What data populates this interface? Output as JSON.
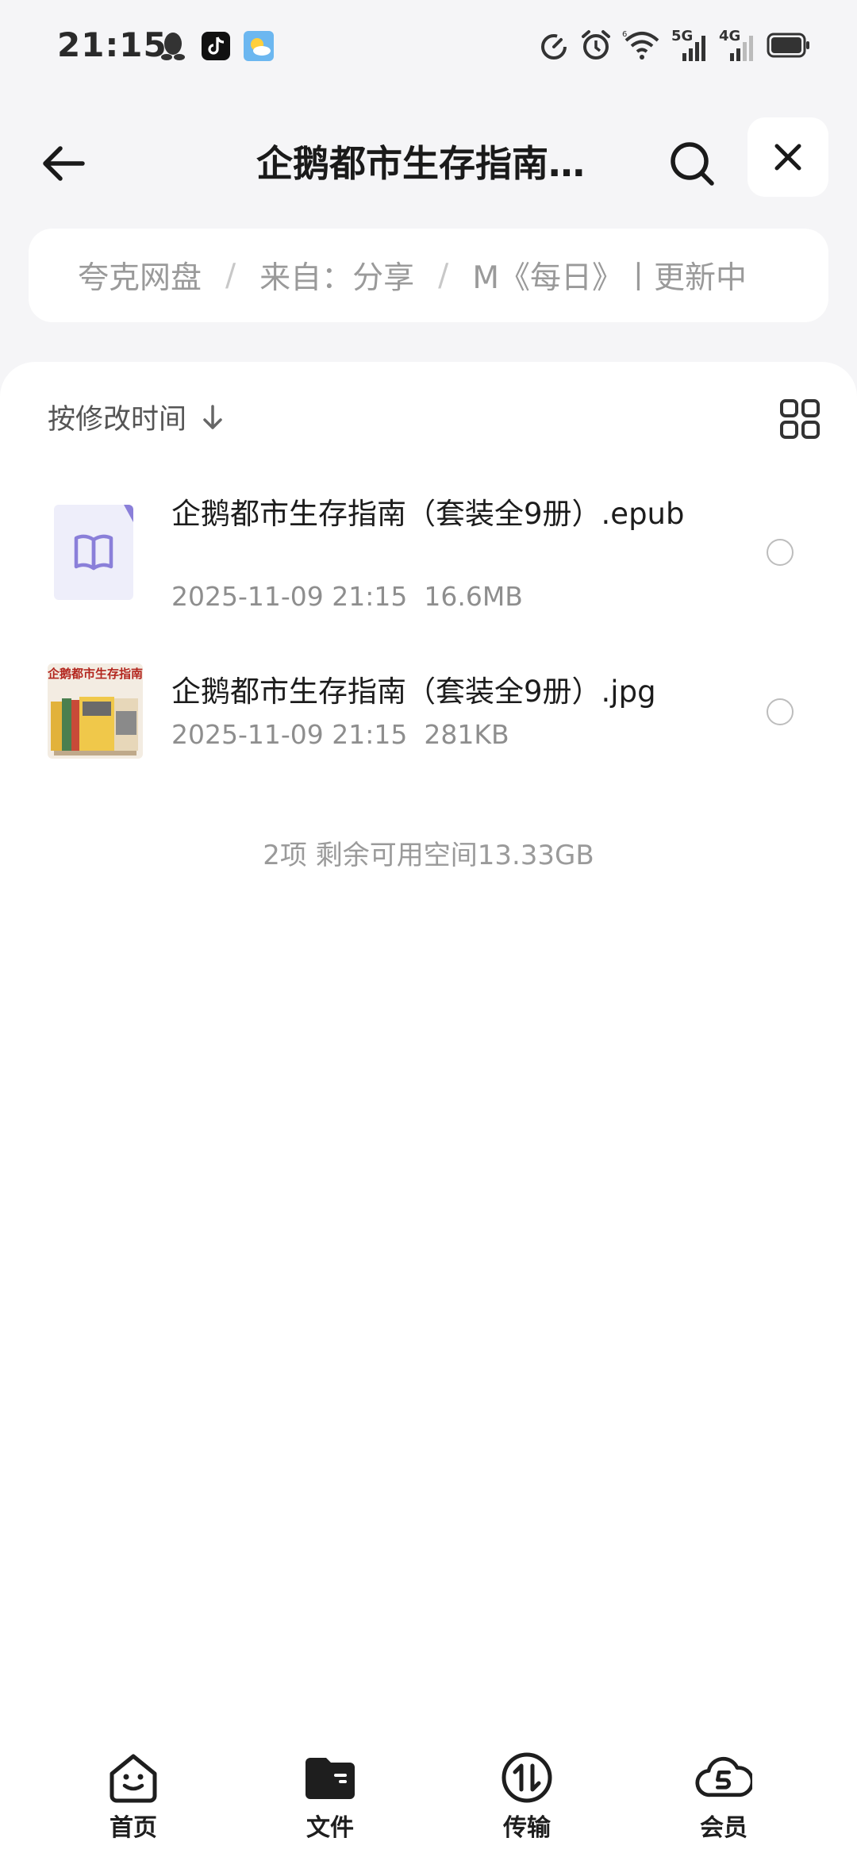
{
  "status_bar": {
    "time": "21:15",
    "left_icons": [
      "qq-icon",
      "tiktok-icon",
      "weather-icon"
    ],
    "right_icons": [
      "speed-icon",
      "alarm-icon",
      "wifi-icon",
      "5g-signal-icon",
      "4g-signal-icon",
      "battery-icon"
    ],
    "network_5g": "5G",
    "network_4g": "4G"
  },
  "header": {
    "title": "企鹅都市生存指南…"
  },
  "breadcrumb": {
    "items": [
      "夸克网盘",
      "来自：分享",
      "M《每日》丨更新中"
    ]
  },
  "toolbar": {
    "sort_label": "按修改时间"
  },
  "files": [
    {
      "name": "企鹅都市生存指南（套装全9册）.epub",
      "date": "2025-11-09 21:15",
      "size": "16.6MB",
      "thumb_icon": "book-icon"
    },
    {
      "name": "企鹅都市生存指南（套装全9册）.jpg",
      "date": "2025-11-09 21:15",
      "size": "281KB",
      "thumb_icon": "book-cover-image",
      "cover_title": "企鹅都市生存指南"
    }
  ],
  "summary": "2项 剩余可用空间13.33GB",
  "bottom_nav": [
    {
      "label": "首页",
      "icon": "home-smile-icon"
    },
    {
      "label": "文件",
      "icon": "folder-icon"
    },
    {
      "label": "传输",
      "icon": "transfer-icon"
    },
    {
      "label": "会员",
      "icon": "vip-cloud-icon"
    }
  ],
  "colors": {
    "background": "#f5f5f7",
    "card": "#ffffff",
    "book_icon": "#8a7fd9",
    "book_bg": "#eeeefa"
  }
}
